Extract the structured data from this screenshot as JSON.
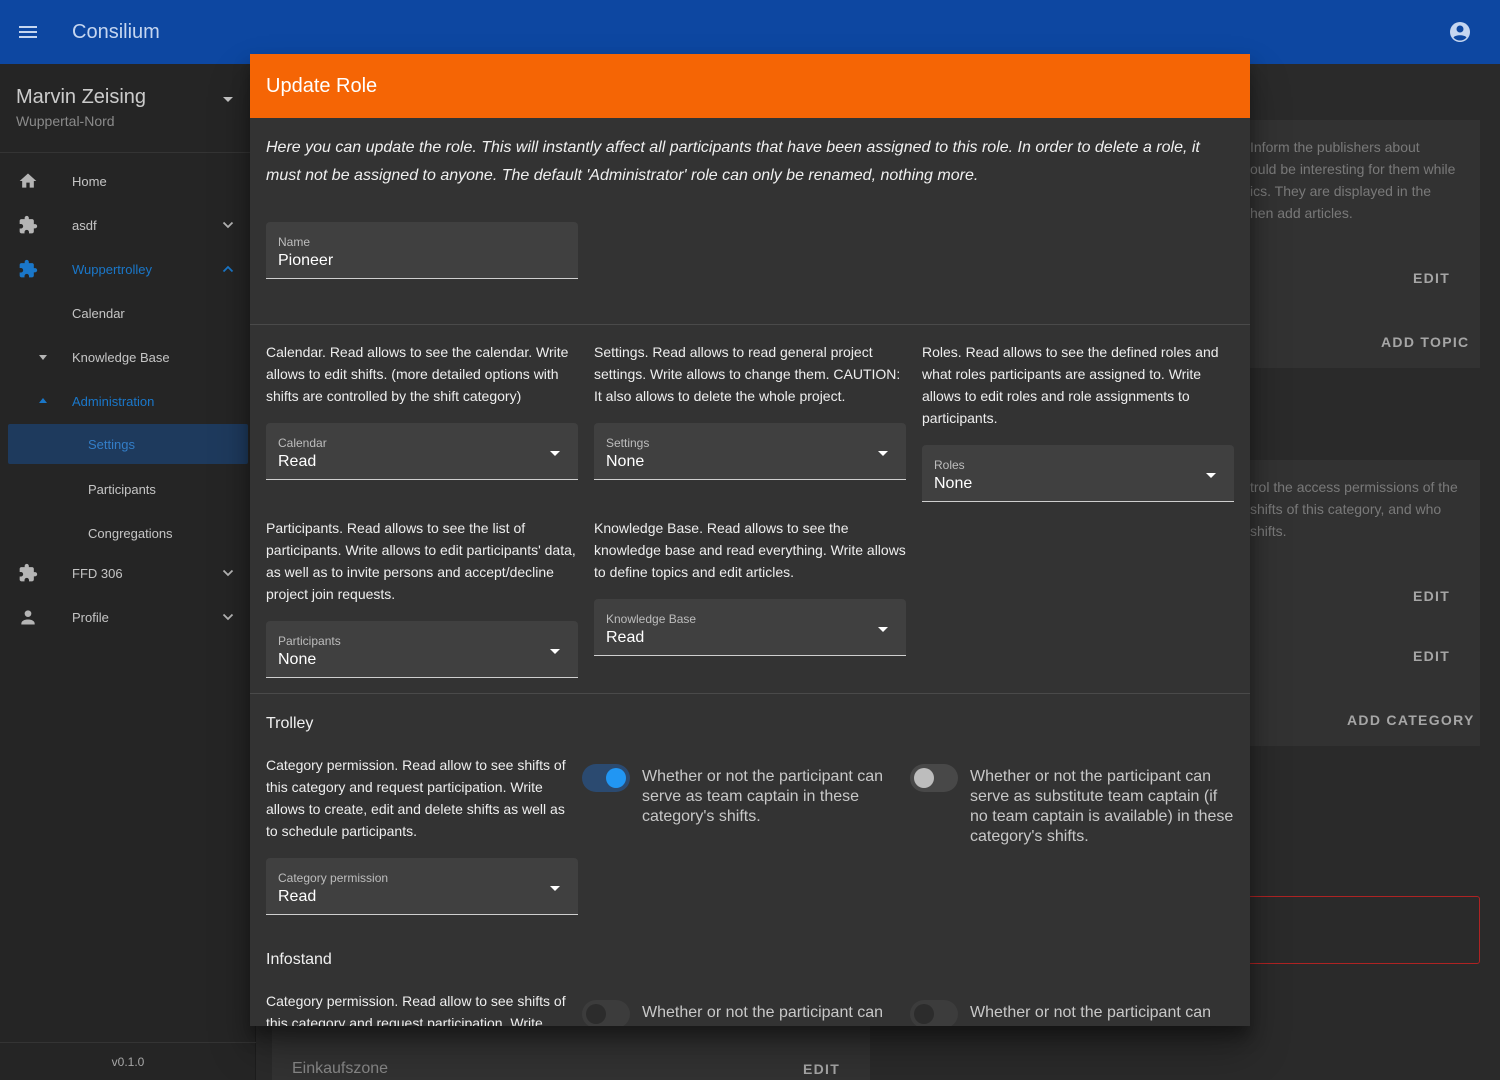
{
  "appbar": {
    "title": "Consilium",
    "menu_icon": "menu-icon",
    "account_icon": "account-circle-icon",
    "color": "#0d47a1"
  },
  "sidebar": {
    "user_name": "Marvin Zeising",
    "congregation": "Wuppertal-Nord",
    "items": [
      {
        "label": "Home",
        "icon": "home-icon"
      },
      {
        "label": "asdf",
        "icon": "puzzle-icon"
      },
      {
        "label": "Wuppertrolley",
        "icon": "puzzle-icon"
      },
      {
        "label": "Calendar"
      },
      {
        "label": "Knowledge Base"
      },
      {
        "label": "Administration"
      },
      {
        "label": "Settings"
      },
      {
        "label": "Participants"
      },
      {
        "label": "Congregations"
      },
      {
        "label": "FFD 306",
        "icon": "puzzle-icon"
      },
      {
        "label": "Profile",
        "icon": "person-icon"
      }
    ],
    "version": "v0.1.0"
  },
  "background": {
    "card1_text": "Inform the publishers about\nould be interesting for them while\nics. They are displayed in the\nhen add articles.",
    "card1_edit": "EDIT",
    "card1_add": "ADD TOPIC",
    "card2_text": "trol the access permissions of the\nshifts of this category, and who\nshifts.",
    "card2_edit1": "EDIT",
    "card2_edit2": "EDIT",
    "card2_add": "ADD CATEGORY",
    "bottom_item": "Einkaufszone",
    "bottom_edit": "EDIT"
  },
  "modal": {
    "title": "Update Role",
    "header_color": "#f56505",
    "intro": "Here you can update the role. This will instantly affect all participants that have been assigned to this role. In order to delete a role, it must not be assigned to anyone. The default 'Administrator' role can only be renamed, nothing more.",
    "name_label": "Name",
    "name_value": "Pioneer",
    "permissions": {
      "calendar": {
        "desc": "Calendar. Read allows to see the calendar. Write allows to edit shifts. (more detailed options with shifts are controlled by the shift category)",
        "label": "Calendar",
        "value": "Read"
      },
      "settings": {
        "desc": "Settings. Read allows to read general project settings. Write allows to change them. CAUTION: It also allows to delete the whole project.",
        "label": "Settings",
        "value": "None"
      },
      "roles": {
        "desc": "Roles. Read allows to see the defined roles and what roles participants are assigned to. Write allows to edit roles and role assignments to participants.",
        "label": "Roles",
        "value": "None"
      },
      "participants": {
        "desc": "Participants. Read allows to see the list of participants. Write allows to edit participants' data, as well as to invite persons and accept/decline project join requests.",
        "label": "Participants",
        "value": "None"
      },
      "knowledge_base": {
        "desc": "Knowledge Base. Read allows to see the knowledge base and read everything. Write allows to define topics and edit articles.",
        "label": "Knowledge Base",
        "value": "Read"
      }
    },
    "categories": [
      {
        "title": "Trolley",
        "desc": "Category permission. Read allow to see shifts of this category and request participation. Write allows to create, edit and delete shifts as well as to schedule participants.",
        "perm_label": "Category permission",
        "perm_value": "Read",
        "captain_text": "Whether or not the participant can serve as team captain in these category's shifts.",
        "captain_on": true,
        "substitute_text": "Whether or not the participant can serve as substitute team captain (if no team captain is available) in these category's shifts.",
        "substitute_on": false
      },
      {
        "title": "Infostand",
        "desc": "Category permission. Read allow to see shifts of this category and request participation. Write",
        "captain_text": "Whether or not the participant can",
        "substitute_text": "Whether or not the participant can"
      }
    ]
  }
}
